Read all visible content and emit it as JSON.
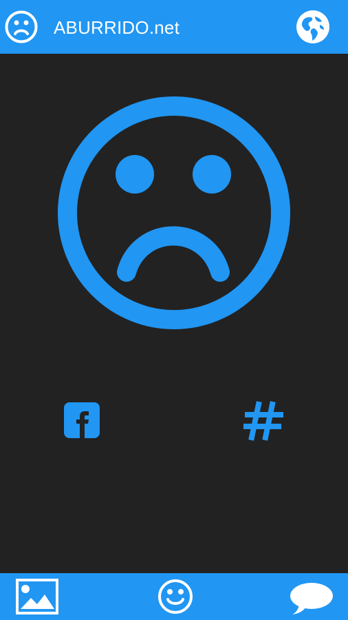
{
  "colors": {
    "accent": "#2196f3",
    "background": "#222222",
    "foreground": "#ffffff"
  },
  "topbar": {
    "title": "ABURRIDO.net",
    "left_icon": "sad-face-icon",
    "right_icon": "globe-icon"
  },
  "main": {
    "hero_icon": "sad-face-icon",
    "share": {
      "facebook_icon": "facebook-icon",
      "hashtag_icon": "hashtag-icon"
    }
  },
  "bottombar": {
    "items": [
      {
        "icon": "gallery-icon"
      },
      {
        "icon": "smile-icon"
      },
      {
        "icon": "chat-icon"
      }
    ]
  }
}
